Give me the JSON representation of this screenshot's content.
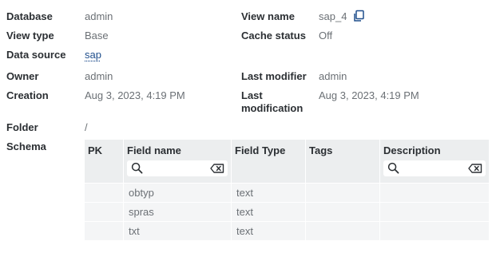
{
  "props": {
    "database_label": "Database",
    "database_value": "admin",
    "view_name_label": "View name",
    "view_name_value": "sap_4",
    "view_type_label": "View type",
    "view_type_value": "Base",
    "cache_status_label": "Cache status",
    "cache_status_value": "Off",
    "data_source_label": "Data source",
    "data_source_value": "sap",
    "owner_label": "Owner",
    "owner_value": "admin",
    "last_modifier_label": "Last modifier",
    "last_modifier_value": "admin",
    "creation_label": "Creation",
    "creation_value": "Aug 3, 2023, 4:19 PM",
    "last_modification_label_1": "Last",
    "last_modification_label_2": "modification",
    "last_modification_value": "Aug 3, 2023, 4:19 PM",
    "folder_label": "Folder",
    "folder_value": "/",
    "schema_label": "Schema"
  },
  "schema": {
    "headers": {
      "pk": "PK",
      "field_name": "Field name",
      "field_type": "Field Type",
      "tags": "Tags",
      "description": "Description"
    },
    "field_search_value": "",
    "description_search_value": "",
    "rows": [
      {
        "pk": "",
        "field_name": "obtyp",
        "field_type": "text",
        "tags": "",
        "description": ""
      },
      {
        "pk": "",
        "field_name": "spras",
        "field_type": "text",
        "tags": "",
        "description": ""
      },
      {
        "pk": "",
        "field_name": "txt",
        "field_type": "text",
        "tags": "",
        "description": ""
      }
    ]
  },
  "icons": {
    "copy": "copy-icon",
    "search": "search-icon",
    "clear": "clear-input-icon"
  },
  "colors": {
    "link": "#1f4e8c",
    "header_bg": "#eceeef",
    "row_bg": "#f4f5f6"
  }
}
